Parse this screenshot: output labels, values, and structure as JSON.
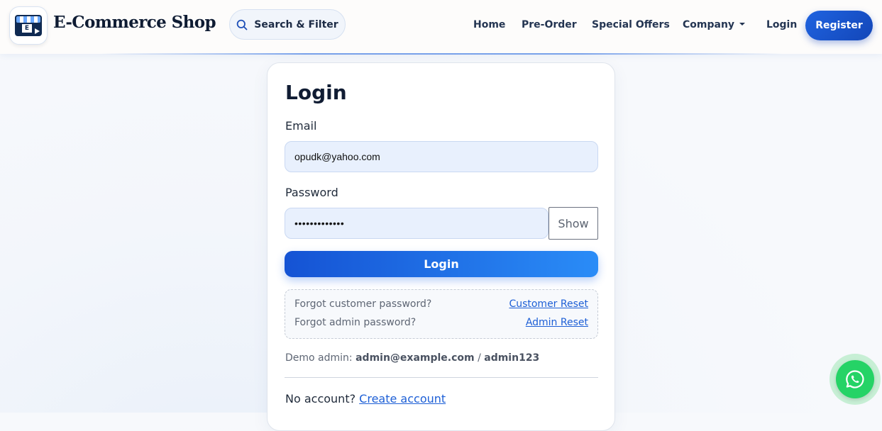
{
  "header": {
    "brand_name": "E-Commerce Shop",
    "logo_icon": "storefront-logo-icon",
    "logo_letter": "E",
    "search_label": "Search & Filter",
    "search_icon": "search-icon",
    "nav": {
      "home": "Home",
      "preorder": "Pre-Order",
      "special_offers": "Special Offers",
      "company": "Company",
      "login": "Login",
      "register": "Register"
    }
  },
  "login_form": {
    "title": "Login",
    "email_label": "Email",
    "email_value": "opudk@yahoo.com",
    "password_label": "Password",
    "password_value": "•••••••••••••",
    "show_label": "Show",
    "submit_label": "Login",
    "reset": {
      "customer_text": "Forgot customer password?",
      "customer_link": "Customer Reset",
      "admin_text": "Forgot admin password?",
      "admin_link": "Admin Reset"
    },
    "demo": {
      "prefix": "Demo admin:",
      "email": "admin@example.com",
      "separator": "/",
      "password": "admin123"
    },
    "no_account_text": "No account?",
    "create_account_link": "Create account"
  },
  "floating": {
    "whatsapp_icon": "whatsapp-icon"
  },
  "colors": {
    "primary": "#1346b8",
    "accent_gradient_start": "#1553d4",
    "accent_gradient_end": "#2a8cf7",
    "input_bg": "#e8f0fd",
    "whatsapp": "#25d366"
  }
}
